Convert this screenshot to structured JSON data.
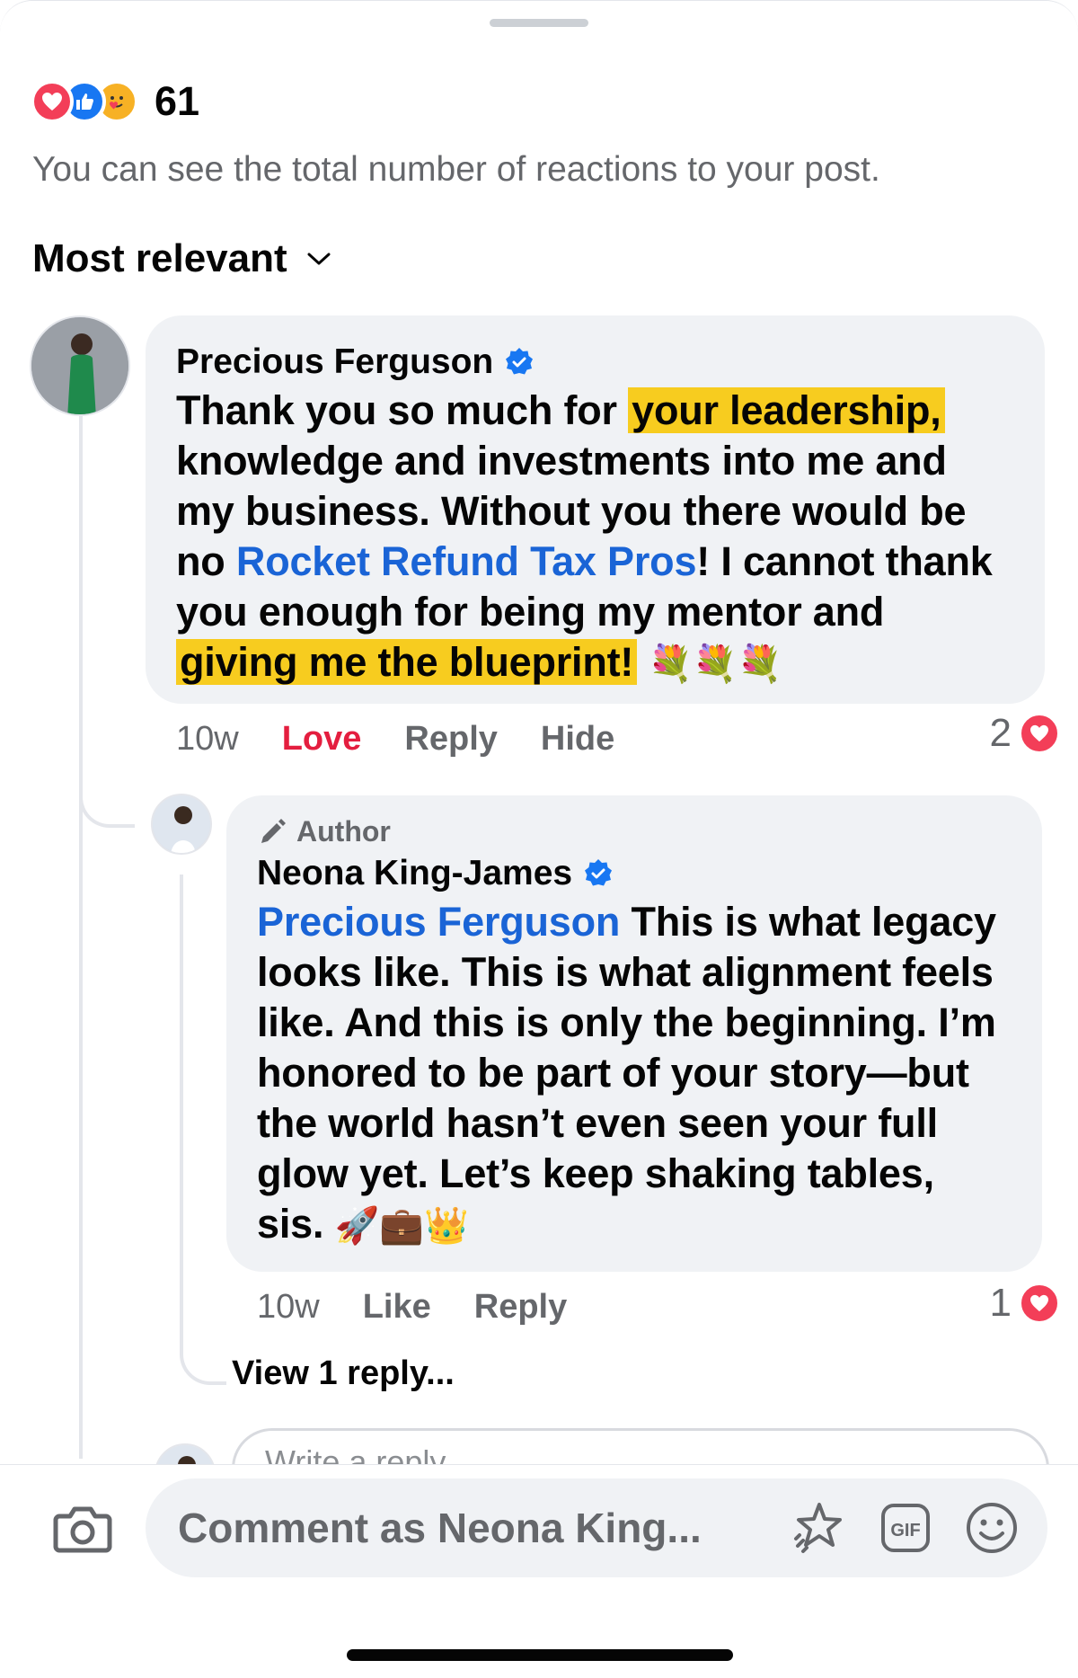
{
  "reactions": {
    "count": "61",
    "note": "You can see the total number of reactions to your post.",
    "icons": [
      "love-icon",
      "like-icon",
      "care-icon"
    ]
  },
  "sort": {
    "label": "Most relevant",
    "icon": "chevron-down-icon"
  },
  "comment": {
    "author": "Precious Ferguson",
    "verified": true,
    "text_parts": {
      "p1": "Thank you so much for ",
      "hl1": "your leadership,",
      "p2": " knowledge and investments into me and my business. Without you there would be no ",
      "mention": "Rocket Refund Tax Pros",
      "p3": "! I cannot thank you enough for being my mentor and ",
      "hl2": "giving me the blueprint!",
      "emoji": " 💐💐💐"
    },
    "time": "10w",
    "actions": [
      "Love",
      "Reply",
      "Hide"
    ],
    "reaction_count": "2"
  },
  "reply": {
    "tag": "Author",
    "author": "Neona King-James",
    "verified": true,
    "mention": "Precious Ferguson",
    "text": " This is what legacy looks like. This is what alignment feels like. And this is only the beginning. I’m honored to be part of your story—but the world hasn’t even seen your full glow yet. Let’s keep shaking tables, sis.",
    "emoji": " 🚀💼👑",
    "time": "10w",
    "actions": [
      "Like",
      "Reply"
    ],
    "reaction_count": "1"
  },
  "view_replies": "View 1 reply...",
  "write_reply_placeholder": "Write a reply...",
  "composer": {
    "placeholder": "Comment as Neona King...",
    "gif_label": "GIF"
  },
  "colors": {
    "accent_blue": "#1877f2",
    "mention_blue": "#1a64d6",
    "love_red": "#e41e3f",
    "highlight_yellow": "#f7cc1f",
    "bubble_bg": "#f0f2f5",
    "muted_text": "#65676b"
  }
}
